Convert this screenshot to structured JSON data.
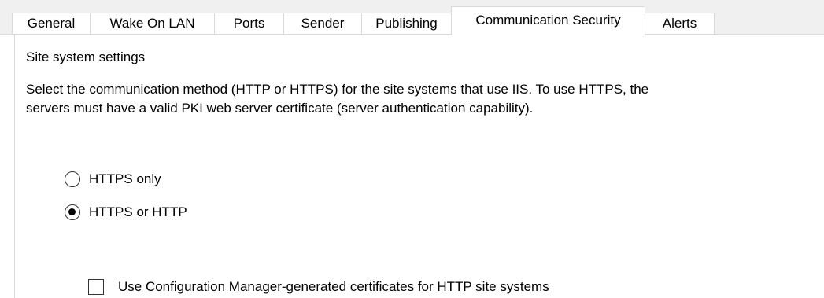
{
  "tabs": [
    {
      "label": "General",
      "active": false
    },
    {
      "label": "Wake On LAN",
      "active": false
    },
    {
      "label": "Ports",
      "active": false
    },
    {
      "label": "Sender",
      "active": false
    },
    {
      "label": "Publishing",
      "active": false
    },
    {
      "label": "Communication Security",
      "active": true
    },
    {
      "label": "Alerts",
      "active": false
    }
  ],
  "section": {
    "heading": "Site system settings",
    "description_line1": "Select the communication method (HTTP or HTTPS) for the site systems that use IIS. To use HTTPS, the",
    "description_line2": "servers must have a valid PKI web server certificate (server authentication capability)."
  },
  "options": {
    "https_only": {
      "label": "HTTPS only",
      "selected": false
    },
    "https_or_http": {
      "label": "HTTPS or HTTP",
      "selected": true
    }
  },
  "use_generated_certs": {
    "label": "Use Configuration Manager-generated certificates for HTTP site systems",
    "checked": false
  },
  "colors": {
    "tab_background": "#f0f0f0",
    "border": "#d9d9d9",
    "control_border": "#333333"
  }
}
